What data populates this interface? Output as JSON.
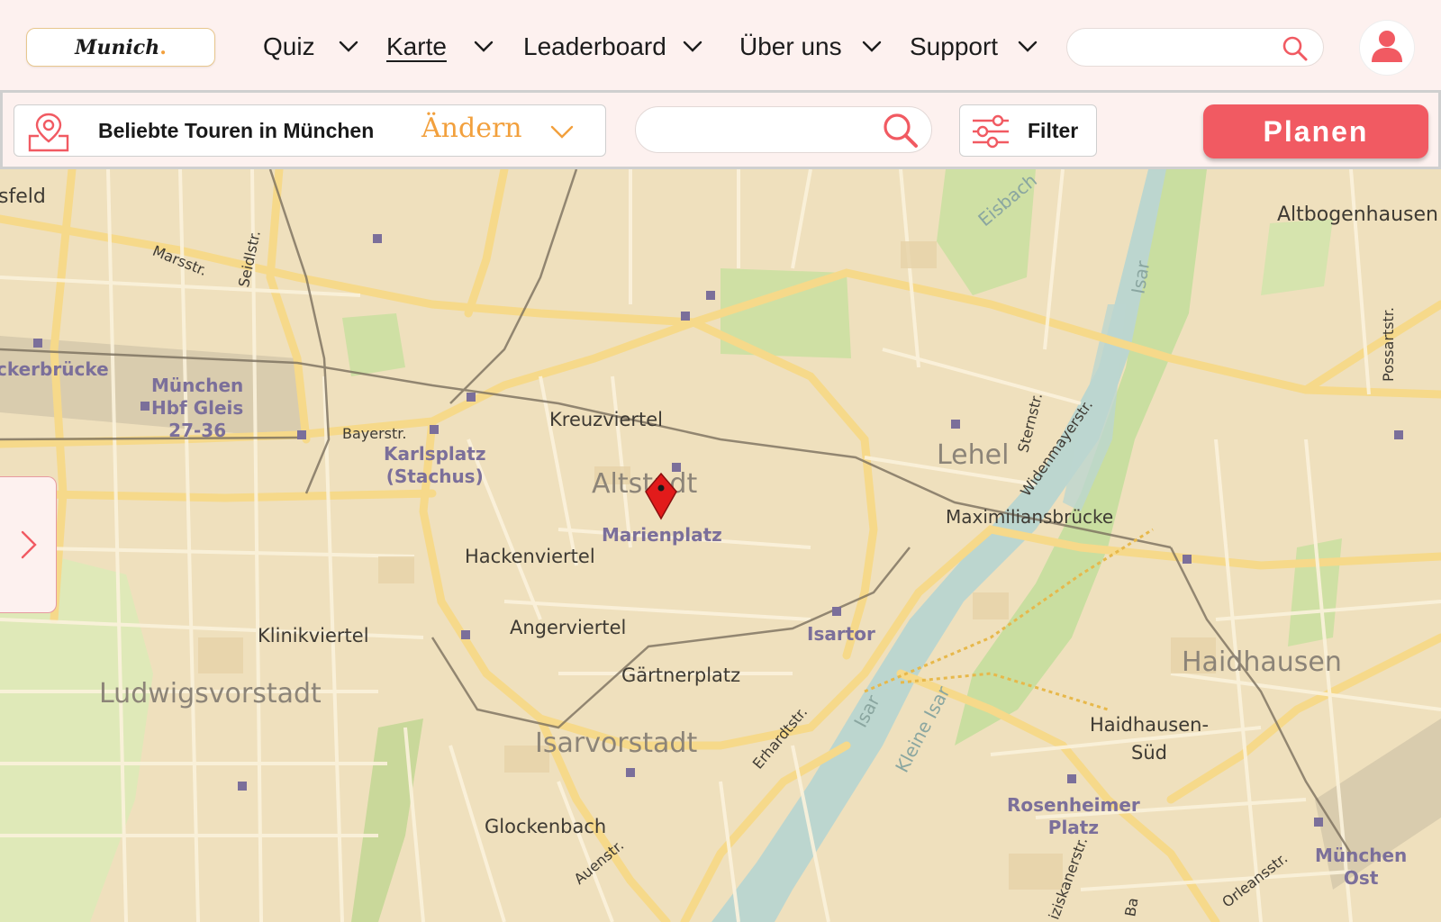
{
  "brand": {
    "logo_text": "Munich",
    "logo_dot": "."
  },
  "nav": {
    "items": [
      {
        "label": "Quiz"
      },
      {
        "label": "Karte"
      },
      {
        "label": "Leaderboard"
      },
      {
        "label": "Über uns"
      },
      {
        "label": "Support"
      }
    ],
    "search": {
      "value": "",
      "placeholder": ""
    }
  },
  "toolbar": {
    "tour_title": "Beliebte Touren in München",
    "change_label": "Ändern",
    "search": {
      "value": "",
      "placeholder": ""
    },
    "filter_label": "Filter",
    "plan_label": "Planen"
  },
  "map": {
    "marker_label": "Marienplatz",
    "labels": {
      "sfeld": "sfeld",
      "altbogenhausen": "Altbogenhausen",
      "kerbruecke": "ckerbrücke",
      "hbf": "München\nHbf Gleis\n27-36",
      "karlsplatz": "Karlsplatz\n(Stachus)",
      "kreuzviertel": "Kreuzviertel",
      "altstadt": "Altstadt",
      "marienplatz": "Marienplatz",
      "lehel": "Lehel",
      "maximiliansbruecke": "Maximiliansbrücke",
      "hackenviertel": "Hackenviertel",
      "klinikviertel": "Klinikviertel",
      "angerviertel": "Angerviertel",
      "isartor": "Isartor",
      "ludwigsvorstadt": "Ludwigsvorstadt",
      "gaertnerplatz": "Gärtnerplatz",
      "haidhausen": "Haidhausen",
      "haidhausen_sued": "Haidhausen-\nSüd",
      "isarvorstadt": "Isarvorstadt",
      "rosenheimer": "Rosenheimer\nPlatz",
      "glockenbach": "Glockenbach",
      "muenchen_ost": "München\nOst",
      "marsstr": "Marsstr.",
      "seidlstr": "Seidlstr.",
      "bayerstr": "Bayerstr.",
      "eisbach": "Eisbach",
      "isar": "Isar",
      "sternstr": "Sternstr.",
      "widenmayerstr": "Widenmayerstr.",
      "possartstr": "Possartstr.",
      "erhardtstr": "Erhardtstr.",
      "kleine_isar": "Kleine Isar",
      "isar2": "Isar",
      "auenstr": "Auenstr.",
      "orleansstr": "Orleansstr.",
      "ziskanerstr": "iziskanerstr.",
      "ba": "Ba"
    }
  },
  "colors": {
    "accent": "#f15a62",
    "orange": "#f2a03d",
    "nav_bg": "#fdf1ef",
    "map_bg": "#efe0bd"
  }
}
